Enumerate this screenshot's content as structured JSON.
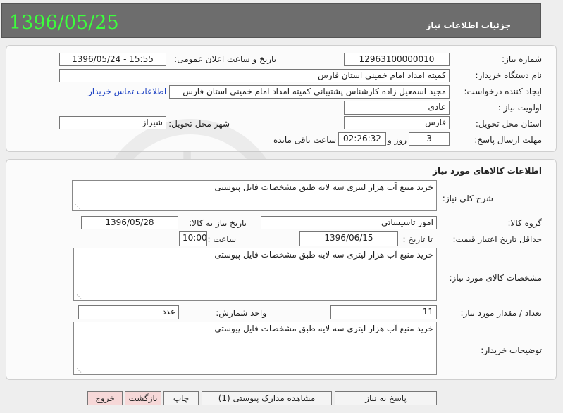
{
  "header": {
    "date": "1396/05/25",
    "title": "جزئیات اطلاعات نیاز"
  },
  "info": {
    "need_number_label": "شماره نیاز:",
    "need_number": "12963100000010",
    "announce_label": "تاریخ و ساعت اعلان عمومی:",
    "announce_value": "1396/05/24 - 15:55",
    "buyer_org_label": "نام دستگاه خریدار:",
    "buyer_org": "کمیته امداد امام خمینی استان فارس",
    "creator_label": "ایجاد کننده درخواست:",
    "creator": "مجید اسمعیل زاده کارشناس پشتیبانی کمیته امداد امام خمینی استان فارس",
    "contact_link": "اطلاعات تماس خریدار",
    "priority_label": "اولویت نیاز :",
    "priority": "عادی",
    "province_label": "استان محل تحویل:",
    "province": "فارس",
    "city_label": "شهر محل تحویل:",
    "city": "شیراز",
    "deadline_label": "مهلت ارسال پاسخ:",
    "days": "3",
    "days_word": "روز و",
    "time_left": "02:26:32",
    "time_left_label": "ساعت باقی مانده"
  },
  "goods": {
    "section_title": "اطلاعات کالاهای مورد نیاز",
    "summary_label": "شرح کلی نیاز:",
    "summary": "خرید منبع آب هزار لیتری سه لایه طبق مشخصات فایل پیوستی",
    "group_label": "گروه کالا:",
    "group": "امور تاسیساتی",
    "need_date_label": "تاریخ نیاز به کالا:",
    "need_date": "1396/05/28",
    "validity_label": "حداقل تاریخ اعتبار قیمت:",
    "until_label": "تا تاریخ :",
    "validity_date": "1396/06/15",
    "hour_label": "ساعت :",
    "validity_time": "10:00",
    "specs_label": "مشخصات کالای مورد نیاز:",
    "specs": "خرید منبع آب هزار لیتری سه لایه طبق مشخصات فایل پیوستی",
    "quantity_label": "تعداد / مقدار مورد نیاز:",
    "quantity": "11",
    "unit_label": "واحد شمارش:",
    "unit": "عدد",
    "buyer_notes_label": "توضیحات خریدار:",
    "buyer_notes": "خرید منبع آب هزار لیتری سه لایه طبق مشخصات فایل پیوستی"
  },
  "buttons": {
    "reply": "پاسخ به نیاز",
    "attachments": "مشاهده مدارک پیوستی (1)",
    "print": "چاپ",
    "back": "بازگشت",
    "exit": "خروج"
  }
}
